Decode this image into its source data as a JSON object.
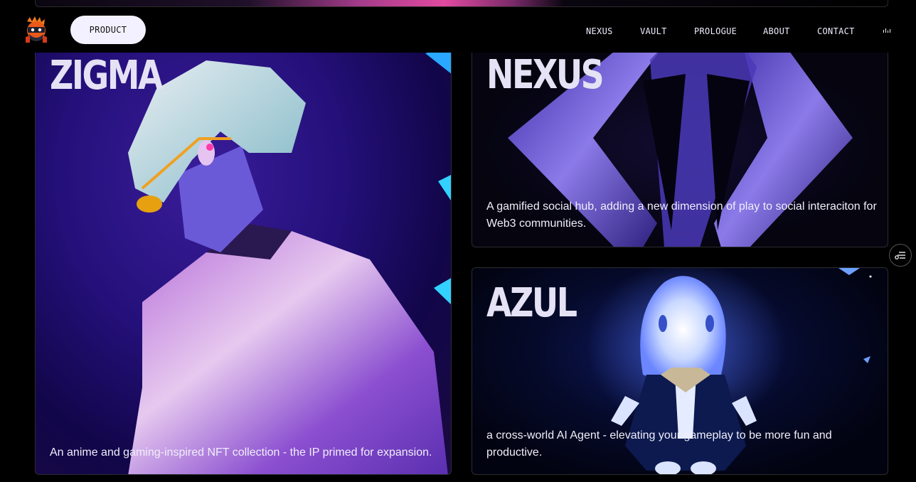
{
  "nav": {
    "logo_icon": "ninja-mascot-icon",
    "product_label": "PRODUCT",
    "links": [
      "NEXUS",
      "VAULT",
      "PROLOGUE",
      "ABOUT",
      "CONTACT"
    ],
    "audio_icon": "sound-bars-icon"
  },
  "cards": {
    "zigma": {
      "title": "ZIGMA",
      "description": "An anime and gaming-inspired NFT collection - the IP primed for expansion."
    },
    "nexus": {
      "title": "NEXUS",
      "description": "A gamified social hub, adding a new dimension of play to social interaciton for Web3 communities."
    },
    "azul": {
      "title": "AZUL",
      "description": "a cross-world AI Agent - elevating your gameplay to be more fun and productive."
    }
  },
  "side_button_icon": "menu-list-icon",
  "colors": {
    "background": "#000000",
    "accent_purple": "#3a1c9a",
    "button_bg": "#f3f1ff",
    "text_light": "#e4e2f4"
  }
}
